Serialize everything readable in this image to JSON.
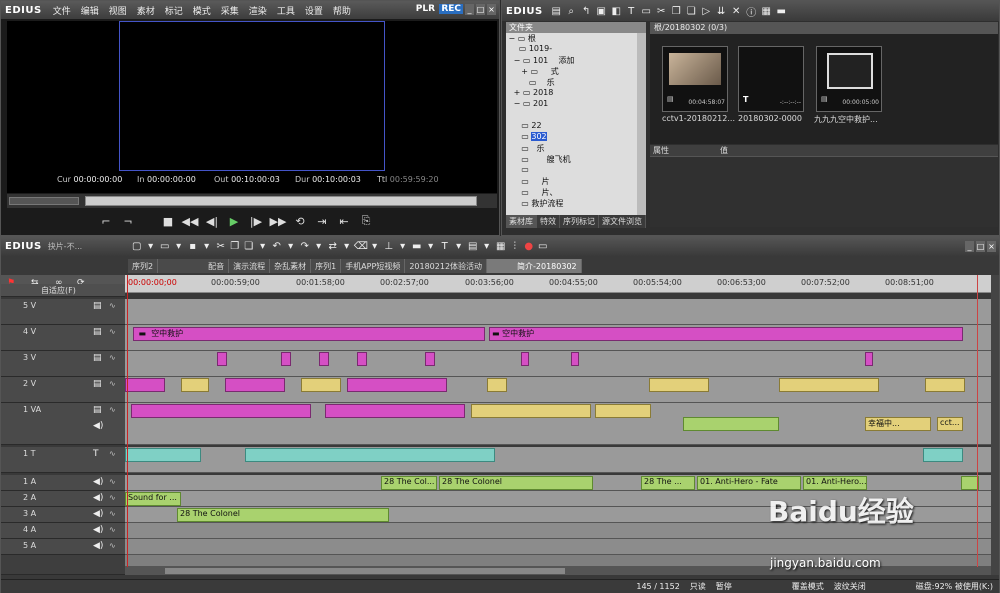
{
  "player": {
    "app": "EDIUS",
    "menu": [
      "文件",
      "编辑",
      "视图",
      "素材",
      "标记",
      "模式",
      "采集",
      "渲染",
      "工具",
      "设置",
      "帮助"
    ],
    "plr": "PLR",
    "rec": "REC",
    "tc": [
      {
        "k": "Cur",
        "v": "00:00:00:00"
      },
      {
        "k": "In",
        "v": "00:00:00:00"
      },
      {
        "k": "Out",
        "v": "00:10:00:03"
      },
      {
        "k": "Dur",
        "v": "00:10:00:03"
      },
      {
        "k": "Ttl",
        "v": "00:59:59:20"
      }
    ]
  },
  "bin": {
    "app": "EDIUS",
    "folder_header": "文件夹",
    "folders": [
      "根",
      "1019-",
      "101",
      "2018",
      "201",
      "22",
      "302",
      "乐",
      "艘飞机",
      "片",
      "片、",
      "救护流程"
    ],
    "folder_extra": [
      "添加",
      "式",
      "乐"
    ],
    "tabs": [
      "素材库",
      "特效",
      "序列标记",
      "源文件浏览"
    ],
    "clip_header": "根/20180302 (0/3)",
    "clips": [
      {
        "name": "cctv1-20180212...",
        "tc": "00:04:58:07"
      },
      {
        "name": "20180302-0000",
        "tc": "-:--:--:--"
      },
      {
        "name": "九九九空中救护...",
        "tc": "00:00:05:00"
      }
    ],
    "prop_col": "属性",
    "val_col": "值"
  },
  "timeline": {
    "app": "EDIUS",
    "proj": "抉片-不...",
    "seq_tabs": [
      "序列2",
      "配音",
      "演示流程",
      "杂乱素材",
      "序列1",
      "手机APP短视频",
      "20180212体验活动",
      "简介-20180302"
    ],
    "active_tab": 7,
    "fit": "自适应(F)",
    "ruler": [
      "00:00:00;00",
      "00:00:59;00",
      "00:01:58;00",
      "00:02:57;00",
      "00:03:56;00",
      "00:04:55;00",
      "00:05:54;00",
      "00:06:53;00",
      "00:07:52;00",
      "00:08:51;00"
    ],
    "tracks": [
      "5 V",
      "4 V",
      "3 V",
      "2 V",
      "1 VA",
      "1 T",
      "1 A",
      "2 A",
      "3 A",
      "4 A",
      "5 A"
    ],
    "v4_clips": [
      "空中救护",
      "空中救护"
    ],
    "va_labels": [
      "幸福中...",
      "cct..."
    ],
    "a1_clips": [
      "28 The Col...",
      "28 The Colonel",
      "28 The ...",
      "01. Anti-Hero - Fate",
      "01. Anti-Hero..."
    ],
    "a2_clip": "Sound for ...",
    "a3_clip": "28 The Colonel",
    "status": [
      "145 / 1152",
      "只读",
      "暂停",
      "覆盖模式",
      "波纹关闭",
      "磁盘:92% 被使用(K:)"
    ]
  },
  "watermark": {
    "main": "Baidu经验",
    "url": "jingyan.baidu.com"
  }
}
